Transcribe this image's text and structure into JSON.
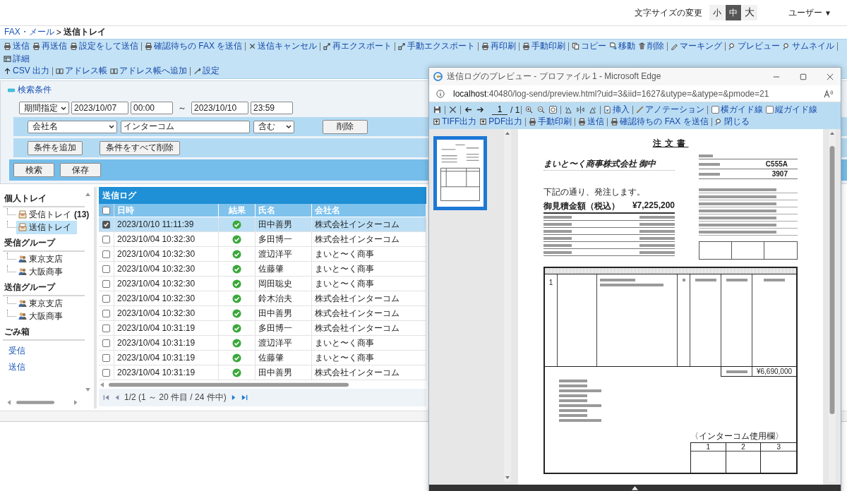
{
  "header": {
    "font_size_label": "文字サイズの変更",
    "font_sizes": [
      {
        "label": "小",
        "selected": false
      },
      {
        "label": "中",
        "selected": true
      },
      {
        "label": "大",
        "selected": false
      }
    ],
    "user_menu": "ユーザー",
    "user_caret": "▼"
  },
  "breadcrumb": {
    "parent": "FAX・メール",
    "separator": ">",
    "current": "送信トレイ"
  },
  "toolbar_rows": [
    [
      [
        {
          "label": "送信",
          "kind": "printer"
        },
        {
          "label": "再送信",
          "kind": "printer"
        },
        {
          "label": "設定をして送信",
          "kind": "printer"
        }
      ],
      [
        {
          "label": "確認待ちの FAX を送信",
          "kind": "printer"
        }
      ],
      [
        {
          "label": "送信キャンセル",
          "kind": "cross"
        }
      ],
      [
        {
          "label": "再エクスポート",
          "kind": "export"
        }
      ],
      [
        {
          "label": "手動エクスポート",
          "kind": "export"
        }
      ],
      [
        {
          "label": "再印刷",
          "kind": "printer"
        }
      ],
      [
        {
          "label": "手動印刷",
          "kind": "printer"
        }
      ],
      [
        {
          "label": "コピー",
          "kind": "copy"
        },
        {
          "label": "移動",
          "kind": "move"
        },
        {
          "label": "削除",
          "kind": "trash"
        }
      ],
      [
        {
          "label": "マーキング",
          "kind": "pen"
        }
      ],
      [
        {
          "label": "プレビュー",
          "kind": "magnifier"
        },
        {
          "label": "サムネイル",
          "kind": "magnifier"
        }
      ],
      [
        {
          "label": "詳細",
          "kind": "detail"
        }
      ]
    ],
    [
      [
        {
          "label": "CSV 出力",
          "kind": "uparrow"
        }
      ],
      [
        {
          "label": "アドレス帳",
          "kind": "book"
        },
        {
          "label": "アドレス帳へ追加",
          "kind": "book"
        }
      ],
      [
        {
          "label": "設定",
          "kind": "wrench"
        }
      ]
    ]
  ],
  "search": {
    "title": "検索条件",
    "expanded": true,
    "period_mode": "期間指定",
    "from_date": "2023/10/07",
    "from_time": "00:00",
    "range_mark": "～",
    "to_date": "2023/10/10",
    "to_time": "23:59",
    "conditions": [
      {
        "field": "会社名",
        "value": "インターコム",
        "operator": "含む",
        "delete": "削除"
      }
    ],
    "add_condition": "条件を追加",
    "clear_conditions": "条件をすべて削除",
    "search_button": "検索",
    "save_button": "保存"
  },
  "tree": {
    "sections": [
      {
        "title": "個人トレイ",
        "items": [
          {
            "label": "受信トレイ",
            "count": "(13)",
            "kind": "tray",
            "selected": false
          },
          {
            "label": "送信トレイ",
            "kind": "tray",
            "selected": true
          }
        ]
      },
      {
        "title": "受信グループ",
        "items": [
          {
            "label": "東京支店",
            "kind": "group",
            "selected": false
          },
          {
            "label": "大阪商事",
            "kind": "group",
            "selected": false
          }
        ]
      },
      {
        "title": "送信グループ",
        "items": [
          {
            "label": "東京支店",
            "kind": "group",
            "selected": false
          },
          {
            "label": "大阪商事",
            "kind": "group",
            "selected": false
          }
        ]
      },
      {
        "title": "ごみ箱"
      }
    ],
    "links": [
      "受信",
      "送信"
    ]
  },
  "log": {
    "title": "送信ログ",
    "all_checked": false,
    "columns": [
      "日時",
      "結果",
      "氏名",
      "会社名"
    ],
    "rows": [
      {
        "checked": true,
        "selected": true,
        "datetime": "2023/10/10 11:11:39",
        "succeeded": true,
        "name": "田中善男",
        "company": "株式会社インターコム"
      },
      {
        "checked": false,
        "selected": false,
        "datetime": "2023/10/04 10:32:30",
        "succeeded": true,
        "name": "多田博一",
        "company": "株式会社インターコム"
      },
      {
        "checked": false,
        "selected": false,
        "datetime": "2023/10/04 10:32:30",
        "succeeded": true,
        "name": "渡辺洋平",
        "company": "まいと〜く商事"
      },
      {
        "checked": false,
        "selected": false,
        "datetime": "2023/10/04 10:32:30",
        "succeeded": true,
        "name": "佐藤肇",
        "company": "まいと〜く商事"
      },
      {
        "checked": false,
        "selected": false,
        "datetime": "2023/10/04 10:32:30",
        "succeeded": true,
        "name": "岡田聡史",
        "company": "まいと〜く商事"
      },
      {
        "checked": false,
        "selected": false,
        "datetime": "2023/10/04 10:32:30",
        "succeeded": true,
        "name": "鈴木治夫",
        "company": "株式会社インターコム"
      },
      {
        "checked": false,
        "selected": false,
        "datetime": "2023/10/04 10:32:30",
        "succeeded": true,
        "name": "田中善男",
        "company": "株式会社インターコム"
      },
      {
        "checked": false,
        "selected": false,
        "datetime": "2023/10/04 10:31:19",
        "succeeded": true,
        "name": "多田博一",
        "company": "株式会社インターコム"
      },
      {
        "checked": false,
        "selected": false,
        "datetime": "2023/10/04 10:31:19",
        "succeeded": true,
        "name": "渡辺洋平",
        "company": "まいと〜く商事"
      },
      {
        "checked": false,
        "selected": false,
        "datetime": "2023/10/04 10:31:19",
        "succeeded": true,
        "name": "佐藤肇",
        "company": "まいと〜く商事"
      },
      {
        "checked": false,
        "selected": false,
        "datetime": "2023/10/04 10:31:19",
        "succeeded": true,
        "name": "田中善男",
        "company": "株式会社インターコム"
      }
    ],
    "pager": "1/2 (1 ～ 20 件目 / 24 件中)"
  },
  "preview": {
    "title": "送信ログのプレビュー - プロファイル 1 - Microsoft Edge",
    "url_host": "localhost",
    "url_rest": ":40480/log-send/preview.html?uid=3&iid=1627&utype=&atype=&pmode=21",
    "page": "1",
    "page_total": "/ 1",
    "insert": "挿入",
    "annotation": "アノテーション",
    "guides": [
      {
        "label": "横ガイド線",
        "checked": false
      },
      {
        "label": "縦ガイド線",
        "checked": false
      }
    ],
    "actions": [
      [
        {
          "label": "TIFF出力",
          "kind": "upload"
        },
        {
          "label": "PDF出力",
          "kind": "upload"
        }
      ],
      [
        {
          "label": "手動印刷",
          "kind": "printer"
        }
      ],
      [
        {
          "label": "送信",
          "kind": "printer"
        }
      ],
      [
        {
          "label": "確認待ちの FAX を送信",
          "kind": "printer"
        }
      ],
      [
        {
          "label": "閉じる",
          "kind": "magnifier"
        }
      ]
    ],
    "thumbnails": [
      {
        "selected": true
      }
    ],
    "document": {
      "title": "注文書",
      "addressee": "まいと〜く商事株式会社 御中",
      "order_no": "C555A",
      "estimate_no": "3907",
      "intro": "下記の通り、発注します。",
      "total_label": "御見積金額（税込）",
      "total": "¥7,225,200",
      "item_no": "1",
      "subtotal": "¥6,690,000",
      "usage_caption": "〈インターコム使用欄〉",
      "usage_columns": [
        "1",
        "2",
        "3"
      ]
    }
  }
}
